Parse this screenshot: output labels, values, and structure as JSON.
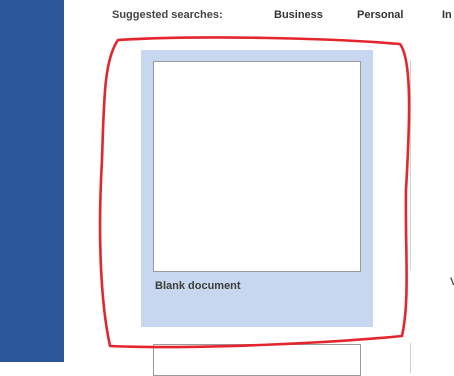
{
  "suggested": {
    "label": "Suggested searches:",
    "items": [
      "Business",
      "Personal",
      "In"
    ]
  },
  "templates": [
    {
      "label": "Blank document"
    }
  ],
  "partial_next_label": "V",
  "highlight_color": "#e3262d",
  "colors": {
    "sidebar": "#2b579a",
    "tile_selected": "#c7d7ef"
  }
}
